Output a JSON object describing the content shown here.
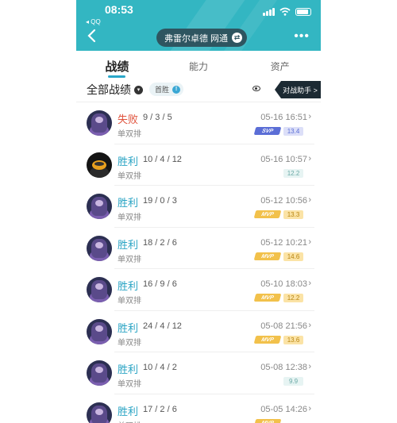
{
  "status_bar": {
    "time": "08:53",
    "back_app": "◂ QQ"
  },
  "header": {
    "title": "弗雷尔卓德 网通"
  },
  "tabs": [
    {
      "label": "战绩",
      "active": true
    },
    {
      "label": "能力",
      "active": false
    },
    {
      "label": "资产",
      "active": false
    }
  ],
  "filter": {
    "label": "全部战绩",
    "first_win_label": "首胜",
    "assistant_label": "对战助手 >"
  },
  "colors": {
    "header_bg": "#33b6c2",
    "win": "#2aa4c4",
    "loss": "#e0523c",
    "mvp_gold": "#f2c14b",
    "svp_blue": "#5b6ed6"
  },
  "matches": [
    {
      "result": "失败",
      "outcome": "loss",
      "kda": "9 / 3 / 5",
      "mode": "单双排",
      "date": "05-16 16:51",
      "badge": "SVP",
      "badge_style": "blue",
      "score": "13.4",
      "score_style": "blue",
      "avatar": "alt-none"
    },
    {
      "result": "胜利",
      "outcome": "win",
      "kda": "10 / 4 / 12",
      "mode": "单双排",
      "date": "05-16 10:57",
      "badge": "",
      "badge_style": "none",
      "score": "12.2",
      "score_style": "plain",
      "avatar": "alt"
    },
    {
      "result": "胜利",
      "outcome": "win",
      "kda": "19 / 0 / 3",
      "mode": "单双排",
      "date": "05-12 10:56",
      "badge": "MVP",
      "badge_style": "gold",
      "score": "13.3",
      "score_style": "gold",
      "avatar": "normal"
    },
    {
      "result": "胜利",
      "outcome": "win",
      "kda": "18 / 2 / 6",
      "mode": "单双排",
      "date": "05-12 10:21",
      "badge": "MVP",
      "badge_style": "gold",
      "score": "14.6",
      "score_style": "gold",
      "avatar": "normal"
    },
    {
      "result": "胜利",
      "outcome": "win",
      "kda": "16 / 9 / 6",
      "mode": "单双排",
      "date": "05-10 18:03",
      "badge": "MVP",
      "badge_style": "gold",
      "score": "12.2",
      "score_style": "gold",
      "avatar": "normal"
    },
    {
      "result": "胜利",
      "outcome": "win",
      "kda": "24 / 4 / 12",
      "mode": "单双排",
      "date": "05-08 21:56",
      "badge": "MVP",
      "badge_style": "gold",
      "score": "13.6",
      "score_style": "gold",
      "avatar": "normal"
    },
    {
      "result": "胜利",
      "outcome": "win",
      "kda": "10 / 4 / 2",
      "mode": "单双排",
      "date": "05-08 12:38",
      "badge": "",
      "badge_style": "none",
      "score": "9.9",
      "score_style": "plain",
      "avatar": "normal"
    },
    {
      "result": "胜利",
      "outcome": "win",
      "kda": "17 / 2 / 6",
      "mode": "单双排",
      "date": "05-05 14:26",
      "badge": "MVP",
      "badge_style": "gold",
      "score": "",
      "score_style": "gold",
      "avatar": "normal"
    }
  ]
}
